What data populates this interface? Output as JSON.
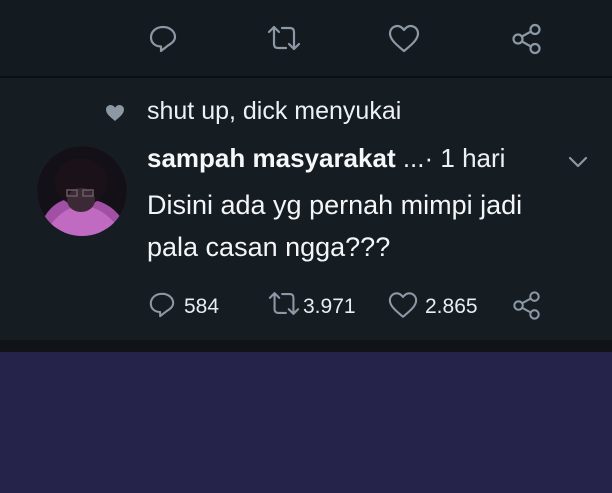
{
  "liked_by": "shut up, dick menyukai",
  "tweet": {
    "author": "sampah masyarakat",
    "ellipsis": " ...",
    "separator": "· ",
    "time": "1 hari",
    "text": "Disini ada yg pernah mimpi jadi pala casan ngga???",
    "counts": {
      "replies": "584",
      "retweets": "3.971",
      "likes": "2.865"
    }
  },
  "icons": {
    "reply": "reply-icon",
    "retweet": "retweet-icon",
    "like": "heart-icon",
    "share": "share-icon",
    "menu": "chevron-down-icon",
    "liked_indicator": "heart-icon"
  },
  "colors": {
    "background": "#151c22",
    "icon": "#8c98a4",
    "text": "#f2f4f6",
    "bottom_panel": "#25234a"
  }
}
